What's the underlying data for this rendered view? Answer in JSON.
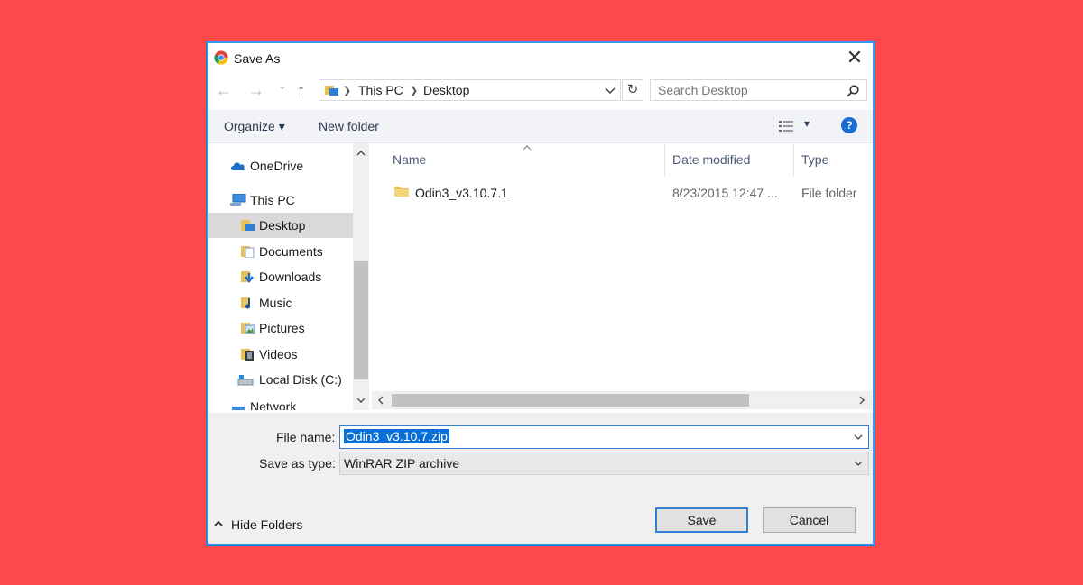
{
  "window": {
    "title": "Save As",
    "close": "✕"
  },
  "nav": {
    "back": "←",
    "forward": "→",
    "recent": "⌄",
    "up": "↑",
    "address": [
      "This PC",
      "Desktop"
    ],
    "refresh": "↻",
    "search_placeholder": "Search Desktop"
  },
  "toolbar": {
    "organize": "Organize ▾",
    "new_folder": "New folder",
    "view": "▾",
    "help": "?"
  },
  "sidebar": {
    "items": [
      {
        "label": "OneDrive",
        "icon": "cloud-icon"
      },
      {
        "label": "This PC",
        "icon": "computer-icon"
      },
      {
        "label": "Desktop",
        "icon": "desktop-folder-icon",
        "selected": true
      },
      {
        "label": "Documents",
        "icon": "documents-folder-icon"
      },
      {
        "label": "Downloads",
        "icon": "downloads-folder-icon"
      },
      {
        "label": "Music",
        "icon": "music-folder-icon"
      },
      {
        "label": "Pictures",
        "icon": "pictures-folder-icon"
      },
      {
        "label": "Videos",
        "icon": "videos-folder-icon"
      },
      {
        "label": "Local Disk (C:)",
        "icon": "disk-icon"
      },
      {
        "label": "Network",
        "icon": "network-icon"
      }
    ]
  },
  "files": {
    "columns": [
      "Name",
      "Date modified",
      "Type"
    ],
    "rows": [
      {
        "name": "Odin3_v3.10.7.1",
        "date": "8/23/2015 12:47 ...",
        "type": "File folder"
      }
    ]
  },
  "form": {
    "file_name_label": "File name:",
    "file_name_value": "Odin3_v3.10.7.zip",
    "save_type_label": "Save as type:",
    "save_type_value": "WinRAR ZIP archive"
  },
  "footer": {
    "hide_folders": "Hide Folders",
    "save": "Save",
    "cancel": "Cancel"
  },
  "colors": {
    "background": "#fc4a4a",
    "accent": "#1c7fd8",
    "selection": "#0a6fd6"
  }
}
